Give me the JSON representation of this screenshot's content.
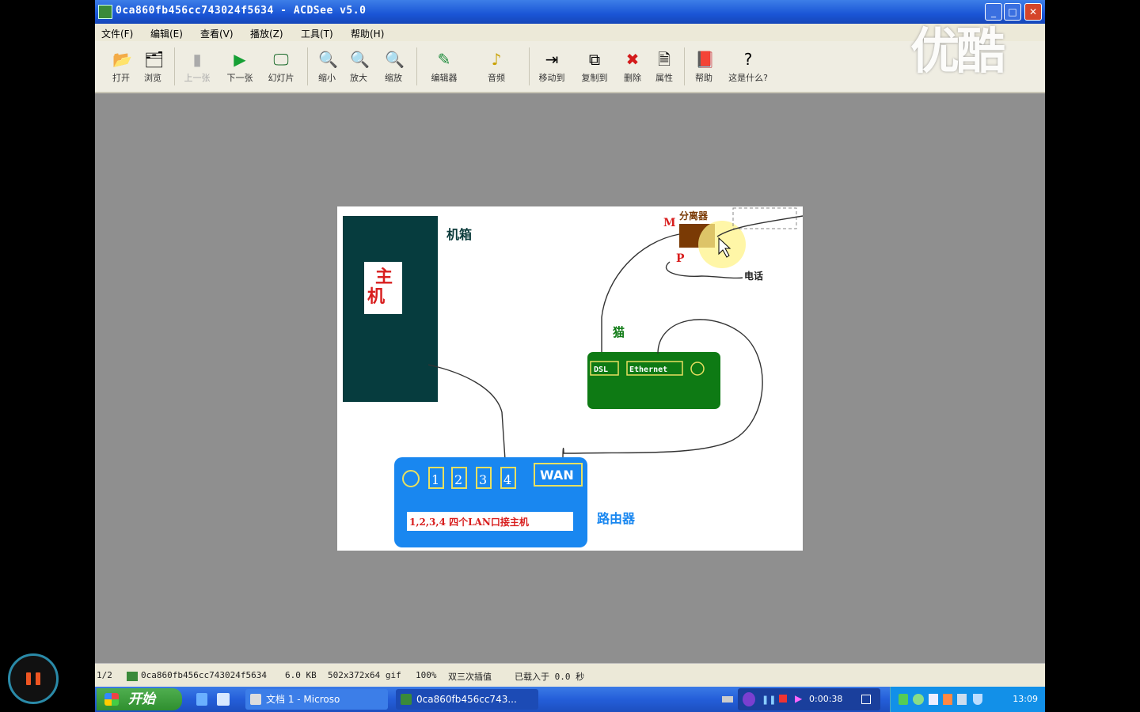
{
  "window": {
    "title": "0ca860fb456cc743024f5634 - ACDSee v5.0"
  },
  "menu": [
    "文件(F)",
    "编辑(E)",
    "查看(V)",
    "播放(Z)",
    "工具(T)",
    "帮助(H)"
  ],
  "toolbar": [
    {
      "label": "打开",
      "icon": "open-folder-icon",
      "glyph": "📂",
      "enabled": true
    },
    {
      "label": "浏览",
      "icon": "browse-icon",
      "glyph": "🗂",
      "enabled": true
    },
    {
      "label": "上一张",
      "icon": "previous-icon",
      "glyph": "▮",
      "enabled": false
    },
    {
      "label": "下一张",
      "icon": "next-icon",
      "glyph": "▶",
      "enabled": true
    },
    {
      "label": "幻灯片",
      "icon": "slideshow-icon",
      "glyph": "🖵",
      "enabled": true
    },
    {
      "label": "缩小",
      "icon": "zoom-out-icon",
      "glyph": "🔍",
      "enabled": true
    },
    {
      "label": "放大",
      "icon": "zoom-in-icon",
      "glyph": "🔍",
      "enabled": true
    },
    {
      "label": "缩放",
      "icon": "zoom-icon",
      "glyph": "🔍",
      "enabled": true
    },
    {
      "label": "编辑器",
      "icon": "editor-icon",
      "glyph": "✎",
      "enabled": true
    },
    {
      "label": "音频",
      "icon": "audio-icon",
      "glyph": "♪",
      "enabled": true
    },
    {
      "label": "移动到",
      "icon": "move-to-icon",
      "glyph": "⇥",
      "enabled": true
    },
    {
      "label": "复制到",
      "icon": "copy-to-icon",
      "glyph": "⧉",
      "enabled": true
    },
    {
      "label": "删除",
      "icon": "delete-icon",
      "glyph": "✖",
      "enabled": true
    },
    {
      "label": "属性",
      "icon": "properties-icon",
      "glyph": "🗎",
      "enabled": true
    },
    {
      "label": "帮助",
      "icon": "help-book-icon",
      "glyph": "📕",
      "enabled": true
    },
    {
      "label": "这是什么?",
      "icon": "whats-this-icon",
      "glyph": "?",
      "enabled": true
    }
  ],
  "diagram": {
    "case_label": "机箱",
    "host_label": "主\n机",
    "splitter_label": "分离器",
    "splitter_m": "M",
    "splitter_p": "P",
    "phone_label": "电话",
    "modem_label": "猫",
    "modem_dsl": "DSL",
    "modem_ethernet": "Ethernet",
    "router_ports": [
      "1",
      "2",
      "3",
      "4"
    ],
    "router_wan": "WAN",
    "router_note": "1,2,3,4 四个LAN口接主机",
    "router_label": "路由器"
  },
  "status": {
    "page": "1/2",
    "file": "0ca860fb456cc743024f5634",
    "size": "6.0 KB",
    "dims": "502x372x64 gif",
    "zoom": "100%",
    "interp": "双三次插值",
    "load": "已载入于 0.0 秒"
  },
  "taskbar": {
    "start": "开始",
    "doc_task": "文档 1 - Microso",
    "acdsee_task": "0ca860fb456cc743...",
    "recorder_time": "0:00:38",
    "clock": "13:09"
  },
  "watermark": "优酷",
  "colors": {
    "case": "#063c3e",
    "modem": "#0e7a14",
    "router": "#1987f0",
    "splitter": "#7a3a05"
  }
}
